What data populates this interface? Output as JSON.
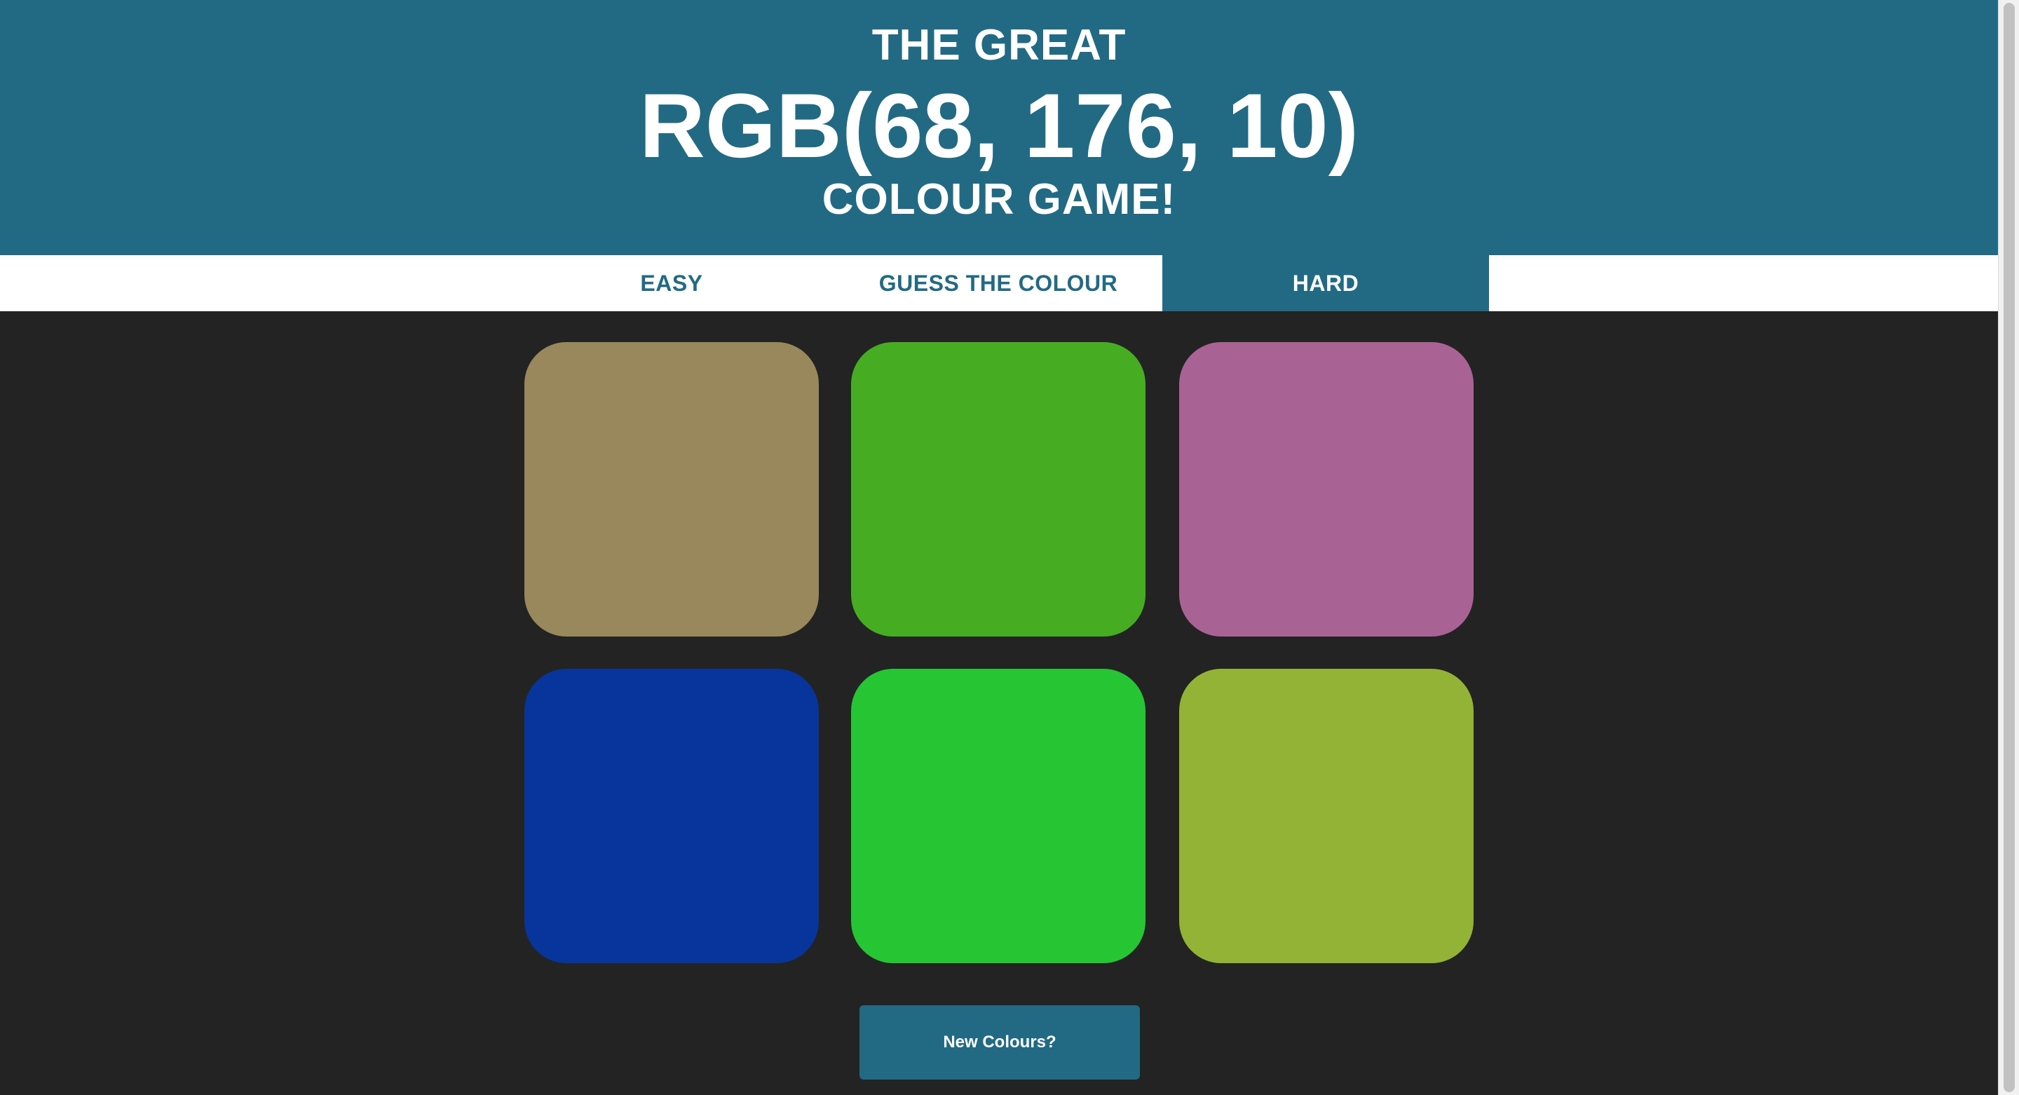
{
  "header": {
    "line1": "THE GREAT",
    "target_color": "RGB(68, 176, 10)",
    "line3": "COLOUR GAME!"
  },
  "nav": {
    "easy_label": "EASY",
    "message": "GUESS THE COLOUR",
    "hard_label": "HARD",
    "selected_mode": "HARD"
  },
  "squares": [
    {
      "color": "#98885c"
    },
    {
      "color": "#46ad23"
    },
    {
      "color": "#a86394"
    },
    {
      "color": "#08359b"
    },
    {
      "color": "#26c534"
    },
    {
      "color": "#93b336"
    }
  ],
  "reset_label": "New Colours?",
  "theme": {
    "header_bg": "#226a83",
    "body_bg": "#232323",
    "nav_bg": "#ffffff",
    "text_light": "#ffffff"
  }
}
